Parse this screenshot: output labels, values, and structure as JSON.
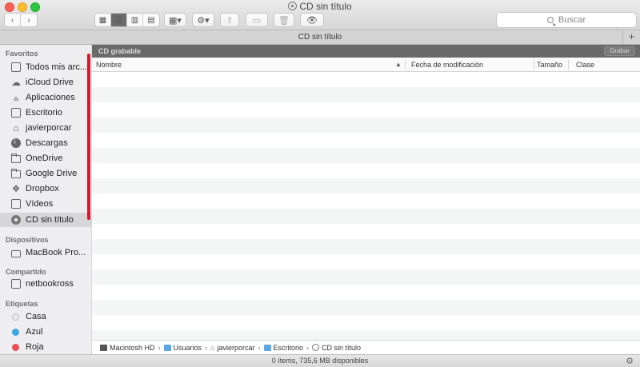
{
  "window": {
    "title": "CD sin título"
  },
  "toolbar": {
    "back_icon": "chevron-left-icon",
    "forward_icon": "chevron-right-icon",
    "view_modes": [
      "icon-view-icon",
      "list-view-icon",
      "column-view-icon",
      "coverflow-view-icon"
    ],
    "active_view": 1,
    "search_placeholder": "Buscar"
  },
  "tab": {
    "label": "CD sin título"
  },
  "sidebar": {
    "sections": [
      {
        "title": "Favoritos",
        "items": [
          {
            "label": "Todos mis arc...",
            "icon": "all-files-icon"
          },
          {
            "label": "iCloud Drive",
            "icon": "cloud-icon"
          },
          {
            "label": "Aplicaciones",
            "icon": "applications-icon"
          },
          {
            "label": "Escritorio",
            "icon": "desktop-icon"
          },
          {
            "label": "javierporcar",
            "icon": "home-icon"
          },
          {
            "label": "Descargas",
            "icon": "downloads-icon"
          },
          {
            "label": "OneDrive",
            "icon": "folder-icon"
          },
          {
            "label": "Google Drive",
            "icon": "folder-icon"
          },
          {
            "label": "Dropbox",
            "icon": "dropbox-icon"
          },
          {
            "label": "Vídeos",
            "icon": "movies-icon"
          },
          {
            "label": "CD sin título",
            "icon": "cd-icon",
            "selected": true
          }
        ]
      },
      {
        "title": "Dispositivos",
        "items": [
          {
            "label": "MacBook Pro...",
            "icon": "laptop-icon"
          }
        ]
      },
      {
        "title": "Compartido",
        "items": [
          {
            "label": "netbookross",
            "icon": "network-computer-icon"
          }
        ]
      },
      {
        "title": "Etiquetas",
        "items": [
          {
            "label": "Casa",
            "color": "#e8e8e8"
          },
          {
            "label": "Azul",
            "color": "#3ea5ea"
          },
          {
            "label": "Roja",
            "color": "#ee4d4d"
          }
        ]
      }
    ]
  },
  "main": {
    "header_title": "CD grabable",
    "burn_button": "Grabar",
    "columns": [
      "Nombre",
      "Fecha de modificación",
      "Tamaño",
      "Clase"
    ]
  },
  "pathbar": {
    "crumbs": [
      "Macintosh HD",
      "Usuarios",
      "javierporcar",
      "Escritorio",
      "CD sin título"
    ]
  },
  "status": {
    "text": "0 ítems, 735,6 MB disponibles"
  },
  "colors": {
    "highlight": "#d8182c",
    "sidebar_bg": "#eeeef0",
    "header_bg": "#6a6a6a"
  }
}
